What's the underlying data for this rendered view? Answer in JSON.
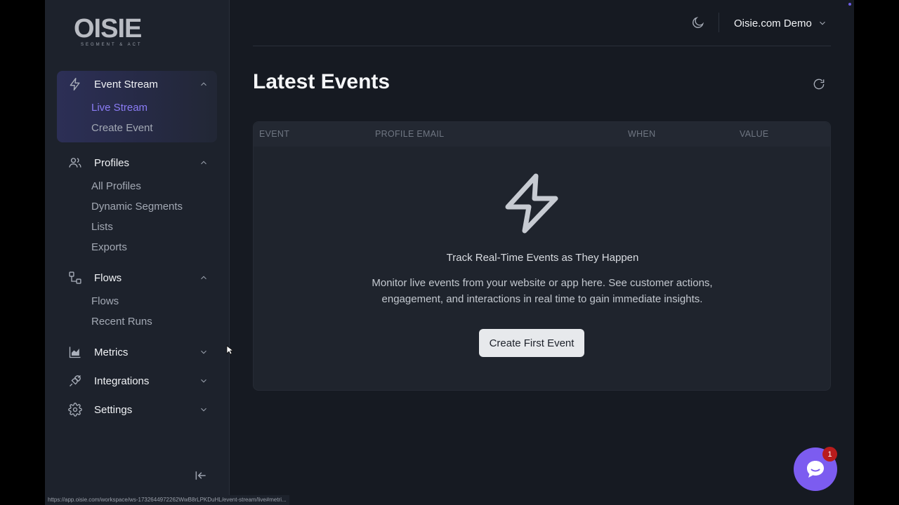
{
  "logo": {
    "name": "OISIE",
    "tagline": "SEGMENT & ACT"
  },
  "sidebar": {
    "groups": [
      {
        "label": "Event Stream",
        "icon": "lightning-icon",
        "expanded": true,
        "items": [
          {
            "label": "Live Stream",
            "current": true
          },
          {
            "label": "Create Event"
          }
        ]
      },
      {
        "label": "Profiles",
        "icon": "users-icon",
        "expanded": true,
        "items": [
          {
            "label": "All Profiles"
          },
          {
            "label": "Dynamic Segments"
          },
          {
            "label": "Lists"
          },
          {
            "label": "Exports"
          }
        ]
      },
      {
        "label": "Flows",
        "icon": "flow-icon",
        "expanded": true,
        "items": [
          {
            "label": "Flows"
          },
          {
            "label": "Recent Runs"
          }
        ]
      },
      {
        "label": "Metrics",
        "icon": "chart-icon",
        "expanded": false,
        "items": []
      },
      {
        "label": "Integrations",
        "icon": "plug-icon",
        "expanded": false,
        "items": []
      },
      {
        "label": "Settings",
        "icon": "gear-icon",
        "expanded": false,
        "items": []
      }
    ]
  },
  "topbar": {
    "workspace": "Oisie.com Demo"
  },
  "main": {
    "title": "Latest Events",
    "table": {
      "columns": [
        "EVENT",
        "PROFILE EMAIL",
        "WHEN",
        "VALUE"
      ]
    },
    "empty": {
      "title": "Track Real-Time Events as They Happen",
      "description": "Monitor live events from your website or app here. See customer actions, engagement, and interactions in real time to gain immediate insights.",
      "cta": "Create First Event"
    }
  },
  "chat": {
    "badge": "1"
  },
  "status_url": "https://app.oisie.com/workspace/ws-1732644972262WwB8rLPKDuHL/event-stream/live#metri...",
  "colors": {
    "accent": "#7c5cf0",
    "active_link": "#8b7cf6",
    "badge": "#b91c1c"
  }
}
